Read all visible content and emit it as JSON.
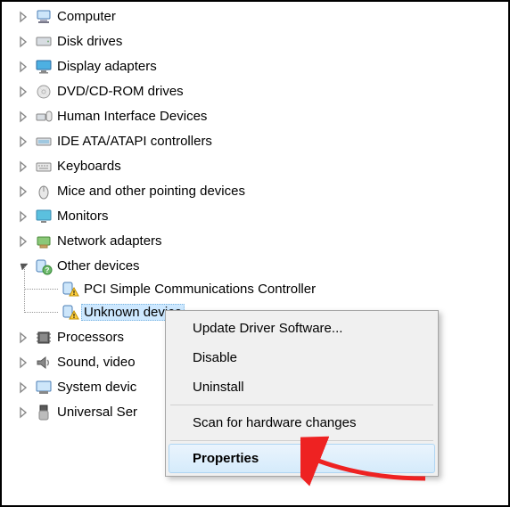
{
  "tree": {
    "computer": "Computer",
    "disk_drives": "Disk drives",
    "display_adapters": "Display adapters",
    "dvd_cdrom": "DVD/CD-ROM drives",
    "hid": "Human Interface Devices",
    "ide": "IDE ATA/ATAPI controllers",
    "keyboards": "Keyboards",
    "mice": "Mice and other pointing devices",
    "monitors": "Monitors",
    "network": "Network adapters",
    "other_devices": "Other devices",
    "other_children": {
      "pci": "PCI Simple Communications Controller",
      "unknown": "Unknown device"
    },
    "processors": "Processors",
    "sound": "Sound, video",
    "system": "System devic",
    "usb": "Universal Ser"
  },
  "context_menu": {
    "update": "Update Driver Software...",
    "disable": "Disable",
    "uninstall": "Uninstall",
    "scan": "Scan for hardware changes",
    "properties": "Properties"
  }
}
